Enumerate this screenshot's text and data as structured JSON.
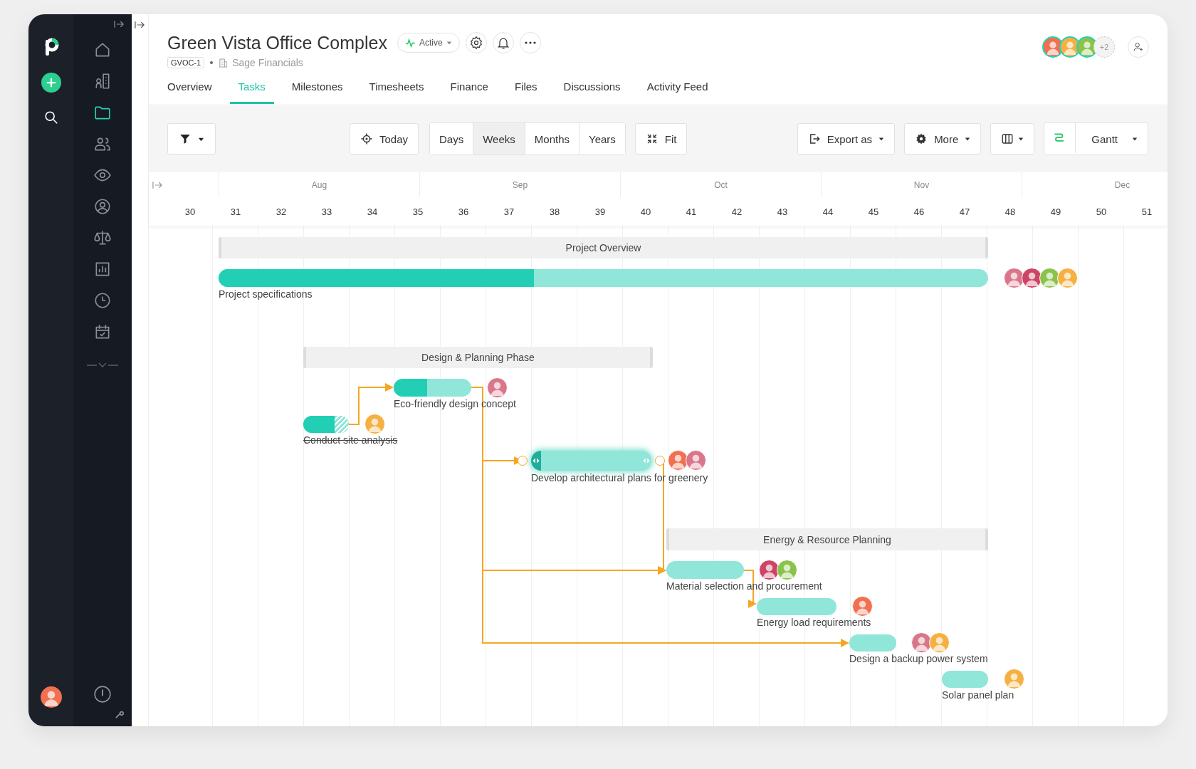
{
  "user": {
    "color": "#f07050"
  },
  "sidebar": {
    "items": [
      {
        "selected": false
      },
      {
        "selected": false
      },
      {
        "selected": true
      },
      {
        "selected": false
      },
      {
        "selected": false
      },
      {
        "selected": false
      },
      {
        "selected": false
      },
      {
        "selected": false
      },
      {
        "selected": false
      },
      {
        "selected": false
      }
    ]
  },
  "project": {
    "title": "Green Vista Office Complex",
    "status": "Active",
    "code": "GVOC-1",
    "client": "Sage Financials",
    "more_members": "+2",
    "members": [
      {
        "color": "#f07050"
      },
      {
        "color": "#f5b041"
      },
      {
        "color": "#8bc34a"
      }
    ]
  },
  "tabs": [
    {
      "label": "Overview",
      "selected": false
    },
    {
      "label": "Tasks",
      "selected": true
    },
    {
      "label": "Milestones",
      "selected": false
    },
    {
      "label": "Timesheets",
      "selected": false
    },
    {
      "label": "Finance",
      "selected": false
    },
    {
      "label": "Files",
      "selected": false
    },
    {
      "label": "Discussions",
      "selected": false
    },
    {
      "label": "Activity Feed",
      "selected": false
    }
  ],
  "toolbar": {
    "today": "Today",
    "fit": "Fit",
    "export": "Export as",
    "more": "More",
    "view": "Gantt",
    "scales": [
      {
        "label": "Days",
        "selected": false
      },
      {
        "label": "Weeks",
        "selected": true
      },
      {
        "label": "Months",
        "selected": false
      },
      {
        "label": "Years",
        "selected": false
      }
    ]
  },
  "timeline": {
    "months": [
      "Aug",
      "Sep",
      "Oct",
      "Nov",
      "Dec"
    ],
    "weeks": [
      "30",
      "31",
      "32",
      "33",
      "34",
      "35",
      "36",
      "37",
      "38",
      "39",
      "40",
      "41",
      "42",
      "43",
      "44",
      "45",
      "46",
      "47",
      "48",
      "49",
      "50",
      "51"
    ]
  },
  "gantt": {
    "items": [
      {
        "kind": "summary",
        "name": "Project Overview"
      },
      {
        "kind": "task",
        "name": "Project specifications",
        "level": 0.41,
        "done": false,
        "selected": false,
        "assignees": [
          {
            "color": "#d9778a"
          },
          {
            "color": "#cc4466"
          },
          {
            "color": "#8bc34a"
          },
          {
            "color": "#f5b041"
          }
        ]
      },
      {
        "kind": "summary",
        "name": "Design & Planning Phase"
      },
      {
        "kind": "task",
        "name": "Eco-friendly design concept",
        "level": 0.43,
        "done": false,
        "selected": false,
        "assignees": [
          {
            "color": "#d9778a"
          }
        ]
      },
      {
        "kind": "task",
        "name": "Conduct site analysis",
        "level": 0.69,
        "done": true,
        "selected": false,
        "assignees": [
          {
            "color": "#f5b041"
          }
        ]
      },
      {
        "kind": "task",
        "name": "Develop architectural plans for greenery",
        "done": false,
        "selected": true,
        "assignees": [
          {
            "color": "#f07050"
          },
          {
            "color": "#d9778a"
          }
        ]
      },
      {
        "kind": "summary",
        "name": "Energy & Resource Planning"
      },
      {
        "kind": "task",
        "name": "Material selection and procurement",
        "done": false,
        "selected": false,
        "assignees": [
          {
            "color": "#cc4466"
          },
          {
            "color": "#8bc34a"
          }
        ]
      },
      {
        "kind": "task",
        "name": "Energy load requirements",
        "done": false,
        "selected": false,
        "assignees": [
          {
            "color": "#f07050"
          }
        ]
      },
      {
        "kind": "task",
        "name": "Design a backup power system",
        "done": false,
        "selected": false,
        "assignees": [
          {
            "color": "#d9778a"
          },
          {
            "color": "#f5b041"
          }
        ]
      },
      {
        "kind": "task",
        "name": "Solar panel plan",
        "done": false,
        "selected": false,
        "assignees": [
          {
            "color": "#f5b041"
          }
        ]
      }
    ]
  }
}
